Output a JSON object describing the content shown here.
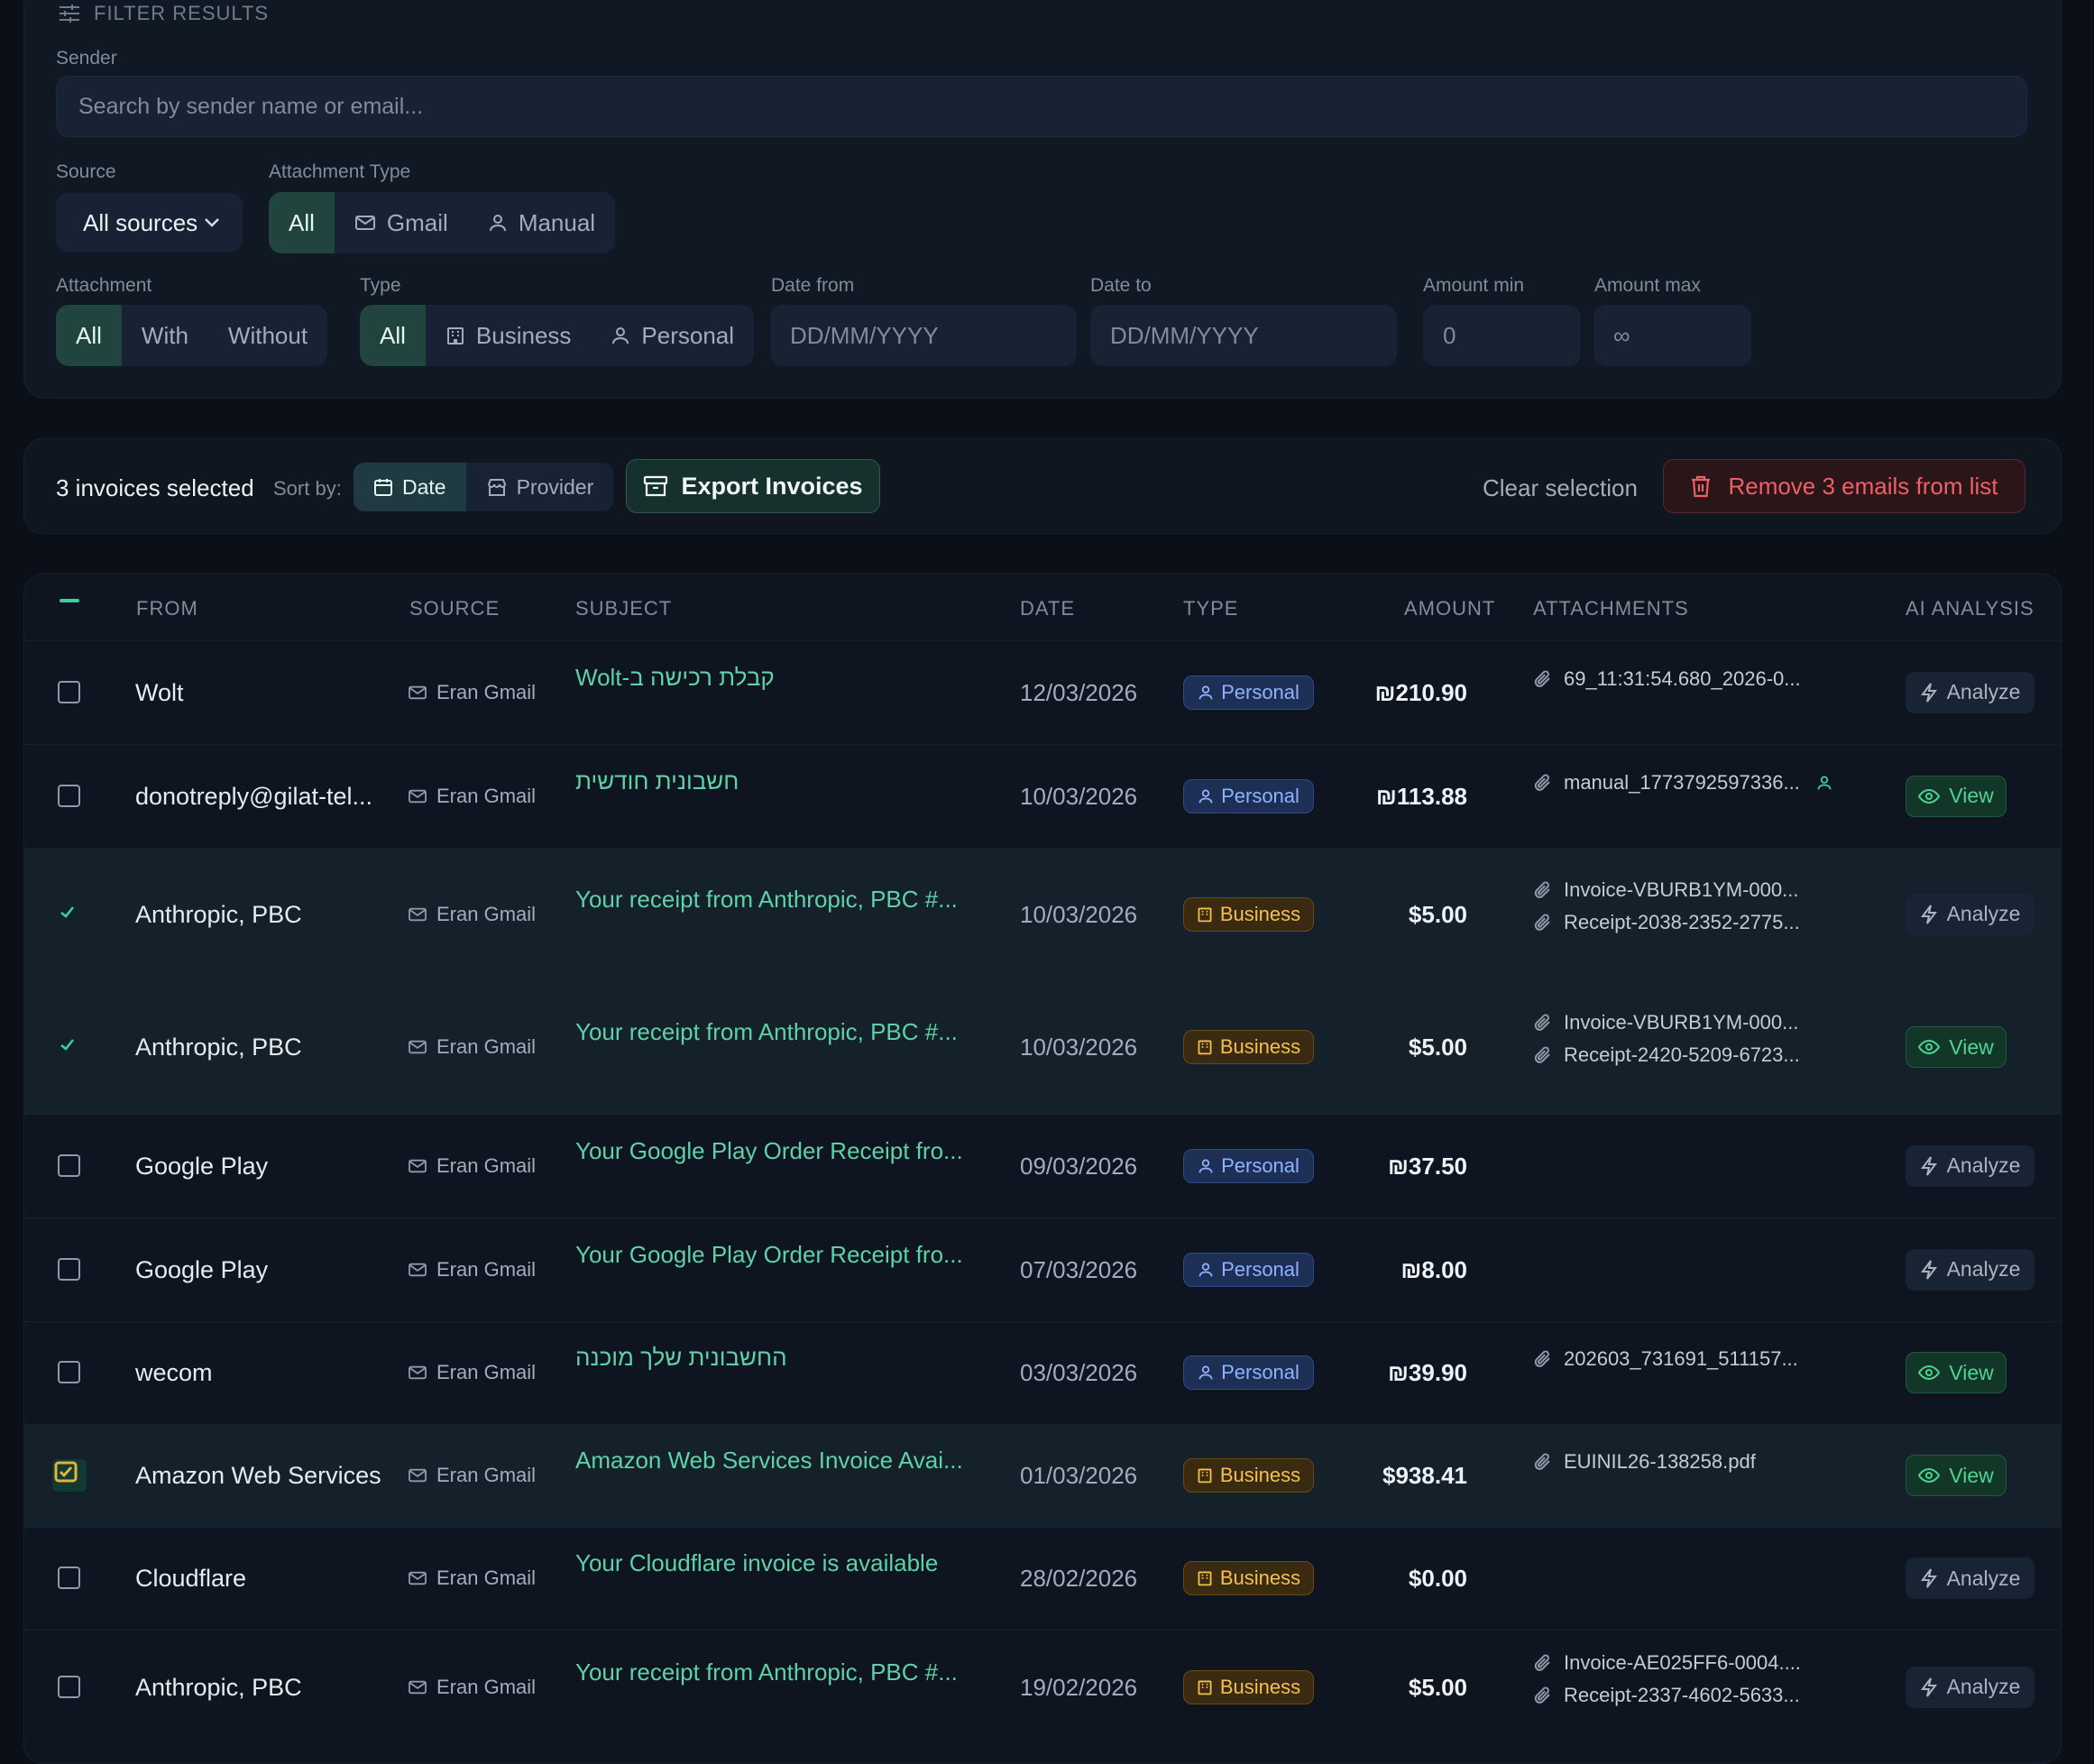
{
  "filters": {
    "title": "FILTER RESULTS",
    "sender_label": "Sender",
    "sender_placeholder": "Search by sender name or email...",
    "source_label": "Source",
    "source_value": "All sources",
    "attachment_type_label": "Attachment Type",
    "attachment_type_options": [
      "All",
      "Gmail",
      "Manual"
    ],
    "attachment_label": "Attachment",
    "attachment_options": [
      "All",
      "With",
      "Without"
    ],
    "type_label": "Type",
    "type_options": [
      "All",
      "Business",
      "Personal"
    ],
    "date_from_label": "Date from",
    "date_from_placeholder": "DD/MM/YYYY",
    "date_to_label": "Date to",
    "date_to_placeholder": "DD/MM/YYYY",
    "amount_min_label": "Amount min",
    "amount_min_placeholder": "0",
    "amount_max_label": "Amount max",
    "amount_max_placeholder": "∞"
  },
  "toolbar": {
    "selected_text": "3 invoices selected",
    "sort_label": "Sort by:",
    "sort_options": [
      "Date",
      "Provider"
    ],
    "export_label": "Export Invoices",
    "clear_label": "Clear selection",
    "remove_label": "Remove 3 emails from list"
  },
  "table": {
    "headers": [
      "FROM",
      "SOURCE",
      "SUBJECT",
      "DATE",
      "TYPE",
      "AMOUNT",
      "ATTACHMENTS",
      "AI ANALYSIS"
    ],
    "rows": [
      {
        "from": "Wolt",
        "source": "Eran Gmail",
        "subject": "קבלת רכישה ב-Wolt",
        "date": "12/03/2026",
        "type": "Personal",
        "amount": "₪210.90",
        "attachments": [
          "69_11:31:54.680_2026-0..."
        ],
        "ai": "Analyze",
        "checked": false
      },
      {
        "from": "donotreply@gilat-tel...",
        "source": "Eran Gmail",
        "subject": "חשבונית חודשית",
        "date": "10/03/2026",
        "type": "Personal",
        "amount": "₪113.88",
        "attachments": [
          "manual_1773792597336..."
        ],
        "ai": "View",
        "checked": false
      },
      {
        "from": "Anthropic, PBC",
        "source": "Eran Gmail",
        "subject": "Your receipt from Anthropic, PBC #...",
        "date": "10/03/2026",
        "type": "Business",
        "amount": "$5.00",
        "attachments": [
          "Invoice-VBURB1YM-000...",
          "Receipt-2038-2352-2775..."
        ],
        "ai": "Analyze",
        "checked": true
      },
      {
        "from": "Anthropic, PBC",
        "source": "Eran Gmail",
        "subject": "Your receipt from Anthropic, PBC #...",
        "date": "10/03/2026",
        "type": "Business",
        "amount": "$5.00",
        "attachments": [
          "Invoice-VBURB1YM-000...",
          "Receipt-2420-5209-6723..."
        ],
        "ai": "View",
        "checked": true
      },
      {
        "from": "Google Play",
        "source": "Eran Gmail",
        "subject": "Your Google Play Order Receipt fro...",
        "date": "09/03/2026",
        "type": "Personal",
        "amount": "₪37.50",
        "attachments": [],
        "ai": "Analyze",
        "checked": false
      },
      {
        "from": "Google Play",
        "source": "Eran Gmail",
        "subject": "Your Google Play Order Receipt fro...",
        "date": "07/03/2026",
        "type": "Personal",
        "amount": "₪8.00",
        "attachments": [],
        "ai": "Analyze",
        "checked": false
      },
      {
        "from": "wecom",
        "source": "Eran Gmail",
        "subject": "החשבונית שלך מוכנה",
        "date": "03/03/2026",
        "type": "Personal",
        "amount": "₪39.90",
        "attachments": [
          "202603_731691_511157..."
        ],
        "ai": "View",
        "checked": false
      },
      {
        "from": "Amazon Web Services",
        "source": "Eran Gmail",
        "subject": "Amazon Web Services Invoice Avai...",
        "date": "01/03/2026",
        "type": "Business",
        "amount": "$938.41",
        "attachments": [
          "EUINIL26-138258.pdf"
        ],
        "ai": "View",
        "checked": true
      },
      {
        "from": "Cloudflare",
        "source": "Eran Gmail",
        "subject": "Your Cloudflare invoice is available",
        "date": "28/02/2026",
        "type": "Business",
        "amount": "$0.00",
        "attachments": [],
        "ai": "Analyze",
        "checked": false
      },
      {
        "from": "Anthropic, PBC",
        "source": "Eran Gmail",
        "subject": "Your receipt from Anthropic, PBC #...",
        "date": "19/02/2026",
        "type": "Business",
        "amount": "$5.00",
        "attachments": [
          "Invoice-AE025FF6-0004....",
          "Receipt-2337-4602-5633..."
        ],
        "ai": "Analyze",
        "checked": false
      }
    ]
  },
  "icons": {
    "filter": "sliders-icon",
    "mail": "mail-icon",
    "user": "user-icon",
    "building": "building-icon",
    "calendar": "calendar-icon",
    "store": "store-icon",
    "archive": "archive-icon",
    "trash": "trash-icon",
    "paperclip": "paperclip-icon",
    "zap": "zap-icon",
    "eye": "eye-icon"
  },
  "colors": {
    "accent": "#5fd1a8",
    "danger": "#ef5f66",
    "personal": "#8fb2ff",
    "business": "#f2c14e"
  }
}
